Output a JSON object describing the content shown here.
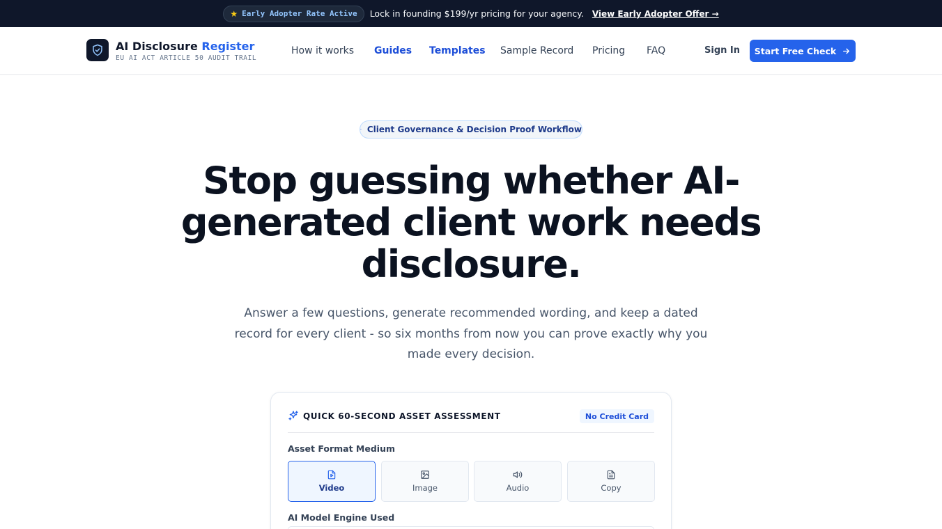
{
  "promo": {
    "badge": "Early Adopter Rate Active",
    "text": "Lock in founding $199/yr pricing for your agency.",
    "link": "View Early Adopter Offer →"
  },
  "brand": {
    "name_part1": "AI Disclosure",
    "name_part2": "Register",
    "tagline": "EU AI ACT ARTICLE 50 AUDIT TRAIL"
  },
  "nav": {
    "items": [
      {
        "label": "How it works"
      },
      {
        "label": "Guides"
      },
      {
        "label": "Templates"
      },
      {
        "label": "Sample Record"
      },
      {
        "label": "Pricing"
      },
      {
        "label": "FAQ"
      }
    ],
    "sign_in": "Sign In",
    "cta": "Start Free Check"
  },
  "hero": {
    "pill": "Client Governance & Decision Proof Workflow",
    "title": "Stop guessing whether AI-generated client work needs disclosure.",
    "subtitle": "Answer a few questions, generate recommended wording, and keep a dated record for every client - so six months from now you can prove exactly why you made every decision."
  },
  "assessment": {
    "title": "QUICK 60-SECOND ASSET ASSESSMENT",
    "badge": "No Credit Card",
    "format_label": "Asset Format Medium",
    "formats": [
      {
        "label": "Video",
        "icon": "video-file-icon",
        "selected": true
      },
      {
        "label": "Image",
        "icon": "image-icon",
        "selected": false
      },
      {
        "label": "Audio",
        "icon": "speaker-icon",
        "selected": false
      },
      {
        "label": "Copy",
        "icon": "document-icon",
        "selected": false
      }
    ],
    "engine_label": "AI Model Engine Used"
  },
  "colors": {
    "primary": "#2563eb",
    "dark": "#0f172a",
    "accent_text": "#1d4ed8"
  }
}
